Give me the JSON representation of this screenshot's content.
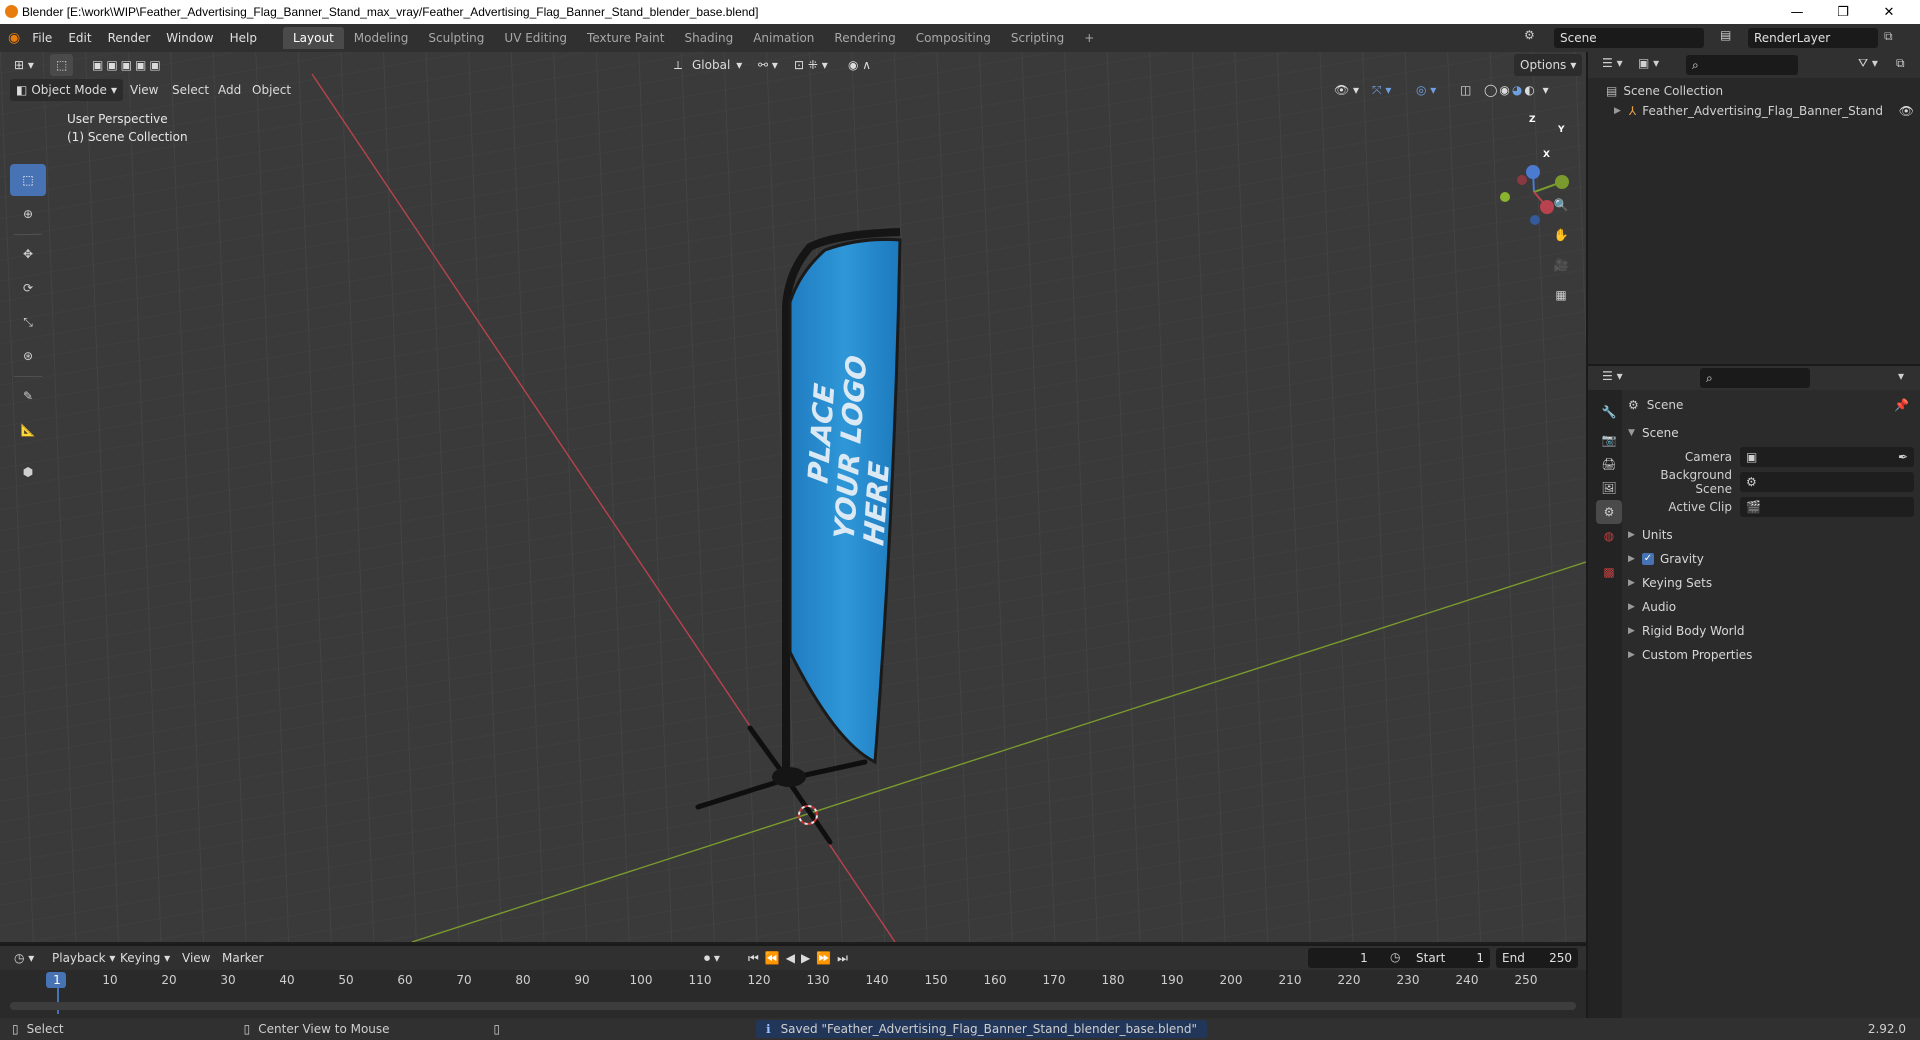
{
  "window": {
    "title": "Blender [E:\\work\\WIP\\Feather_Advertising_Flag_Banner_Stand_max_vray/Feather_Advertising_Flag_Banner_Stand_blender_base.blend]",
    "controls": [
      "—",
      "❐",
      "✕"
    ]
  },
  "menubar": {
    "menus": [
      "File",
      "Edit",
      "Render",
      "Window",
      "Help"
    ],
    "workspaces": [
      "Layout",
      "Modeling",
      "Sculpting",
      "UV Editing",
      "Texture Paint",
      "Shading",
      "Animation",
      "Rendering",
      "Compositing",
      "Scripting"
    ],
    "active_workspace": "Layout",
    "add_tab": "+",
    "scene": "Scene",
    "render_layer": "RenderLayer"
  },
  "viewport": {
    "mode": "Object Mode",
    "menus": [
      "View",
      "Select",
      "Add",
      "Object"
    ],
    "orientation": "Global",
    "options_label": "Options",
    "overlay_line1": "User Perspective",
    "overlay_line2": "(1) Scene Collection",
    "flag_text_line1": "PLACE",
    "flag_text_line2": "YOUR LOGO HERE",
    "gizmo_axes": {
      "x": "X",
      "y": "Y",
      "z": "Z"
    },
    "colors": {
      "x_axis": "#b8424e",
      "y_axis": "#7a9a2e",
      "z_axis": "#4a7bd1",
      "flag": "#2a8fd0",
      "grid_bg": "#3a3a3a",
      "selected_tool": "#4772b3"
    },
    "tools": [
      "select-box",
      "cursor",
      "move",
      "rotate",
      "scale",
      "transform",
      "annotate",
      "measure",
      "add-cube"
    ]
  },
  "outliner": {
    "root": "Scene Collection",
    "items": [
      {
        "name": "Feather_Advertising_Flag_Banner_Stand",
        "visible": true
      }
    ]
  },
  "properties": {
    "context": "Scene",
    "section": "Scene",
    "fields": [
      {
        "label": "Camera",
        "value": ""
      },
      {
        "label": "Background Scene",
        "value": ""
      },
      {
        "label": "Active Clip",
        "value": ""
      }
    ],
    "panels": [
      {
        "label": "Units",
        "checkbox": false
      },
      {
        "label": "Gravity",
        "checkbox": true
      },
      {
        "label": "Keying Sets",
        "checkbox": false
      },
      {
        "label": "Audio",
        "checkbox": false
      },
      {
        "label": "Rigid Body World",
        "checkbox": false
      },
      {
        "label": "Custom Properties",
        "checkbox": false
      }
    ]
  },
  "timeline": {
    "menus": [
      "Playback",
      "Keying",
      "View",
      "Marker"
    ],
    "current_frame": "1",
    "start_label": "Start",
    "start": "1",
    "end_label": "End",
    "end": "250",
    "ruler": [
      "1",
      "10",
      "20",
      "30",
      "40",
      "50",
      "60",
      "70",
      "80",
      "90",
      "100",
      "110",
      "120",
      "130",
      "140",
      "150",
      "160",
      "170",
      "180",
      "190",
      "200",
      "210",
      "220",
      "230",
      "240",
      "250"
    ]
  },
  "statusbar": {
    "left_hint": "Select",
    "middle_hint": "Center View to Mouse",
    "message": "Saved \"Feather_Advertising_Flag_Banner_Stand_blender_base.blend\"",
    "version": "2.92.0"
  }
}
